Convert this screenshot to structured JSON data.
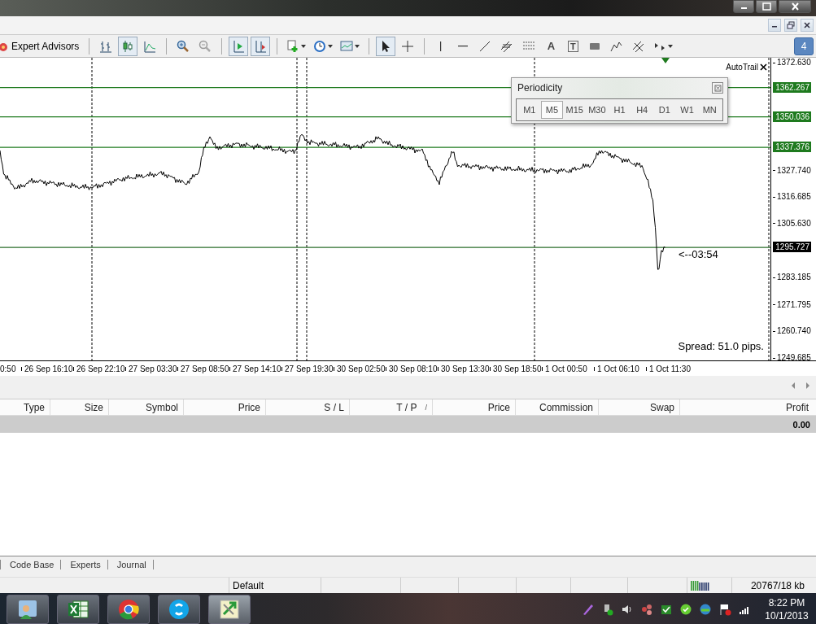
{
  "toolbar": {
    "expert_advisors": "Expert Advisors",
    "text_tool": "A",
    "text_label_tool": "T",
    "alerts_badge": "4"
  },
  "chart": {
    "autotrail": "AutoTrail",
    "price_ticks": [
      "1372.630",
      "1327.740",
      "1316.685",
      "1305.630",
      "1283.185",
      "1271.795",
      "1260.740",
      "1249.685"
    ],
    "levels": [
      {
        "price": "1362.267",
        "kind": "level"
      },
      {
        "price": "1350.036",
        "kind": "level"
      },
      {
        "price": "1337.376",
        "kind": "level"
      },
      {
        "price": "1295.727",
        "kind": "bid"
      }
    ],
    "time_labels": [
      "0:50",
      "26 Sep 16:10",
      "26 Sep 22:10",
      "27 Sep 03:30",
      "27 Sep 08:50",
      "27 Sep 14:10",
      "27 Sep 19:30",
      "30 Sep 02:50",
      "30 Sep 08:10",
      "30 Sep 13:30",
      "30 Sep 18:50",
      "1 Oct 00:50",
      "1 Oct 06:10",
      "1 Oct 11:30"
    ],
    "countdown": "<--03:54",
    "spread": "Spread: 51.0 pips."
  },
  "periodicity": {
    "title": "Periodicity",
    "periods": [
      {
        "label": "M1",
        "selected": false
      },
      {
        "label": "M5",
        "selected": true
      },
      {
        "label": "M15",
        "selected": false
      },
      {
        "label": "M30",
        "selected": false
      },
      {
        "label": "H1",
        "selected": false
      },
      {
        "label": "H4",
        "selected": false
      },
      {
        "label": "D1",
        "selected": false
      },
      {
        "label": "W1",
        "selected": false
      },
      {
        "label": "MN",
        "selected": false
      }
    ]
  },
  "terminal": {
    "columns": [
      {
        "label": "Type"
      },
      {
        "label": "Size"
      },
      {
        "label": "Symbol"
      },
      {
        "label": "Price"
      },
      {
        "label": "S / L"
      },
      {
        "label": "T / P",
        "sort_mark": "/"
      },
      {
        "label": "Price"
      },
      {
        "label": "Commission"
      },
      {
        "label": "Swap"
      },
      {
        "label": "Profit"
      }
    ],
    "total_profit": "0.00"
  },
  "terminal_tabs": [
    {
      "label": "Code Base"
    },
    {
      "label": "Experts"
    },
    {
      "label": "Journal"
    }
  ],
  "status_bar": {
    "profile": "Default",
    "memory": "20767/18 kb"
  },
  "taskbar": {
    "clock_time": "8:22 PM",
    "clock_date": "10/1/2013"
  }
}
